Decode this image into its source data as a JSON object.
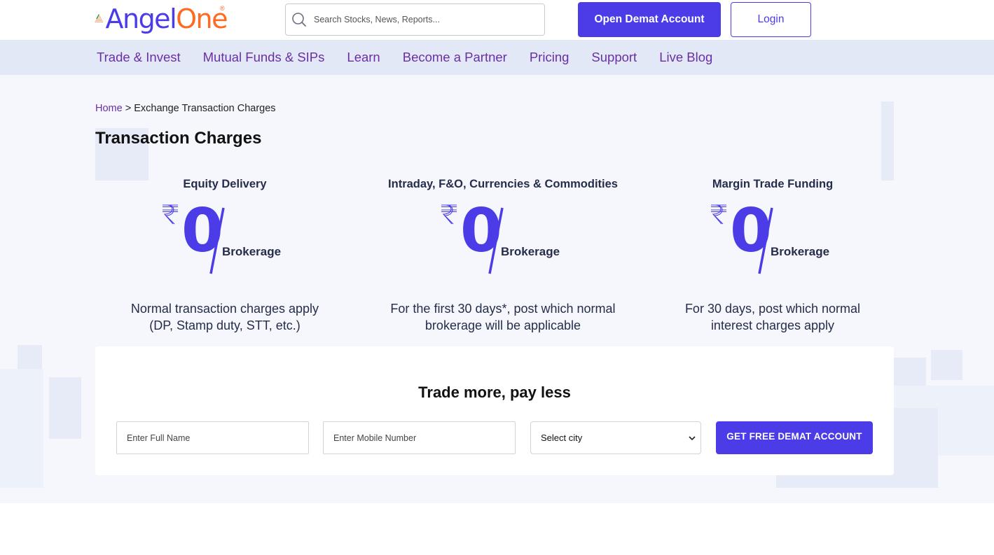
{
  "header": {
    "logo_primary": "Angel",
    "logo_secondary": "One",
    "logo_reg": "®",
    "search_placeholder": "Search Stocks, News, Reports...",
    "open_account_label": "Open Demat Account",
    "login_label": "Login"
  },
  "nav": {
    "items": [
      {
        "label": "Trade & Invest"
      },
      {
        "label": "Mutual Funds & SIPs"
      },
      {
        "label": "Learn"
      },
      {
        "label": "Become a Partner"
      },
      {
        "label": "Pricing"
      },
      {
        "label": "Support"
      },
      {
        "label": "Live Blog"
      }
    ]
  },
  "breadcrumb": {
    "home": "Home",
    "separator": ">",
    "current": "Exchange Transaction Charges"
  },
  "page_title": "Transaction Charges",
  "cards": [
    {
      "title": "Equity Delivery",
      "amount": "0",
      "amount_label": "Brokerage",
      "description_line1": "Normal transaction charges apply",
      "description_line2": "(DP, Stamp duty, STT, etc.)"
    },
    {
      "title": "Intraday, F&O, Currencies & Commodities",
      "amount": "0",
      "amount_label": "Brokerage",
      "description_line1": "For the first 30 days*, post which normal",
      "description_line2": "brokerage will be applicable"
    },
    {
      "title": "Margin Trade Funding",
      "amount": "0",
      "amount_label": "Brokerage",
      "description_line1": "For 30 days, post which normal",
      "description_line2": "interest charges apply"
    }
  ],
  "form": {
    "title": "Trade more, pay less",
    "name_placeholder": "Enter Full Name",
    "mobile_placeholder": "Enter Mobile Number",
    "city_selected": "Select city",
    "submit_label": "GET FREE DEMAT ACCOUNT"
  },
  "colors": {
    "brand_primary": "#4b3ce8",
    "brand_accent": "#ff6a1f",
    "nav_background": "#e3e8f7",
    "nav_text": "#6a2fa3"
  },
  "icons": {
    "search": "search-icon",
    "rupee": "rupee-icon",
    "dropdown": "chevron-down-icon"
  }
}
